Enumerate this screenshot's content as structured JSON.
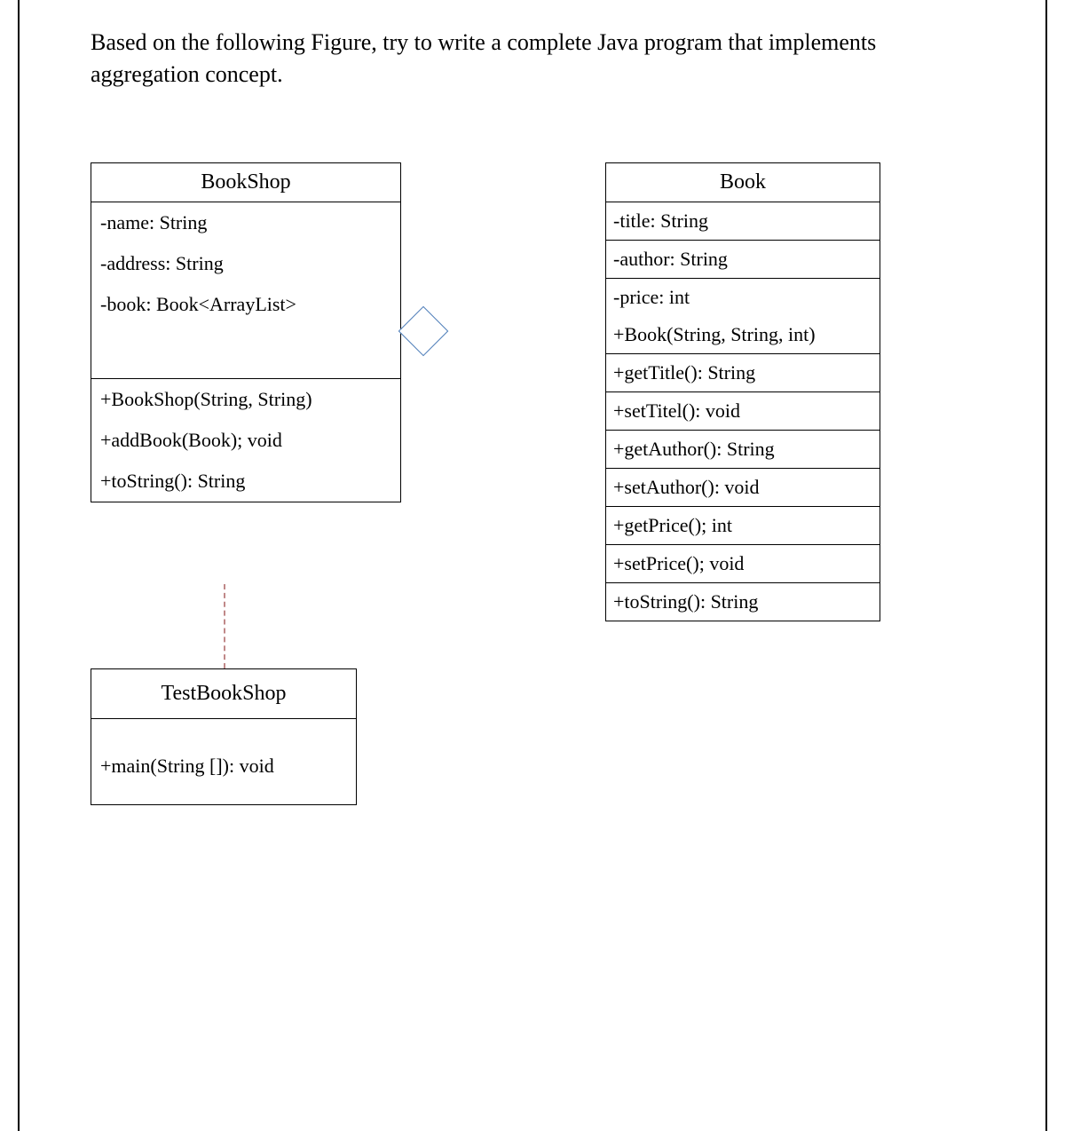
{
  "prompt": "Based on the following Figure, try to write a complete Java program that implements aggregation concept.",
  "bookshop": {
    "title": "BookShop",
    "attrs": [
      "-name: String",
      "-address: String",
      "-book: Book<ArrayList>"
    ],
    "methods": [
      "+BookShop(String, String)",
      "+addBook(Book); void",
      "+toString(): String"
    ]
  },
  "book": {
    "title": "Book",
    "rows": [
      "-title: String",
      "-author: String",
      "-price: int",
      "+Book(String, String, int)",
      "+getTitle(): String",
      "+setTitel(): void",
      "+getAuthor(): String",
      "+setAuthor(): void",
      "+getPrice(); int",
      "+setPrice(); void",
      "+toString(): String"
    ]
  },
  "testbookshop": {
    "title": "TestBookShop",
    "methods": [
      "+main(String []): void"
    ]
  }
}
